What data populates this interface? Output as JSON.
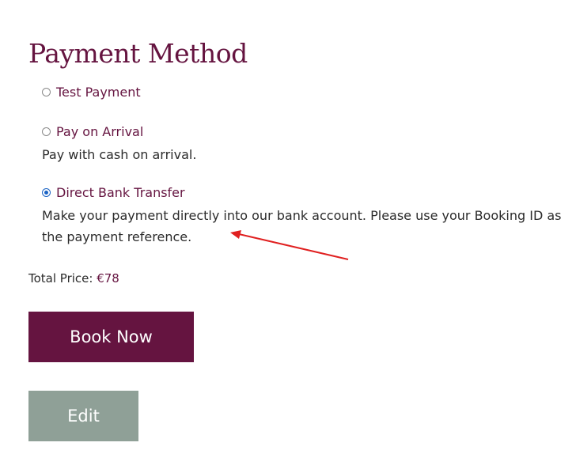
{
  "page": {
    "title": "Payment Method"
  },
  "payment_options": [
    {
      "label": "Test Payment",
      "selected": false,
      "description": ""
    },
    {
      "label": "Pay on Arrival",
      "selected": false,
      "description": "Pay with cash on arrival."
    },
    {
      "label": "Direct Bank Transfer",
      "selected": true,
      "description": "Make your payment directly into our bank account. Please use your Booking ID as the payment reference."
    }
  ],
  "total": {
    "label": "Total Price: ",
    "amount": "€78"
  },
  "buttons": {
    "book_now": "Book Now",
    "edit": "Edit"
  },
  "colors": {
    "brand": "#651440",
    "edit_button": "#8fa097",
    "radio_selected": "#1a63c4",
    "annotation_arrow": "#e02020"
  }
}
